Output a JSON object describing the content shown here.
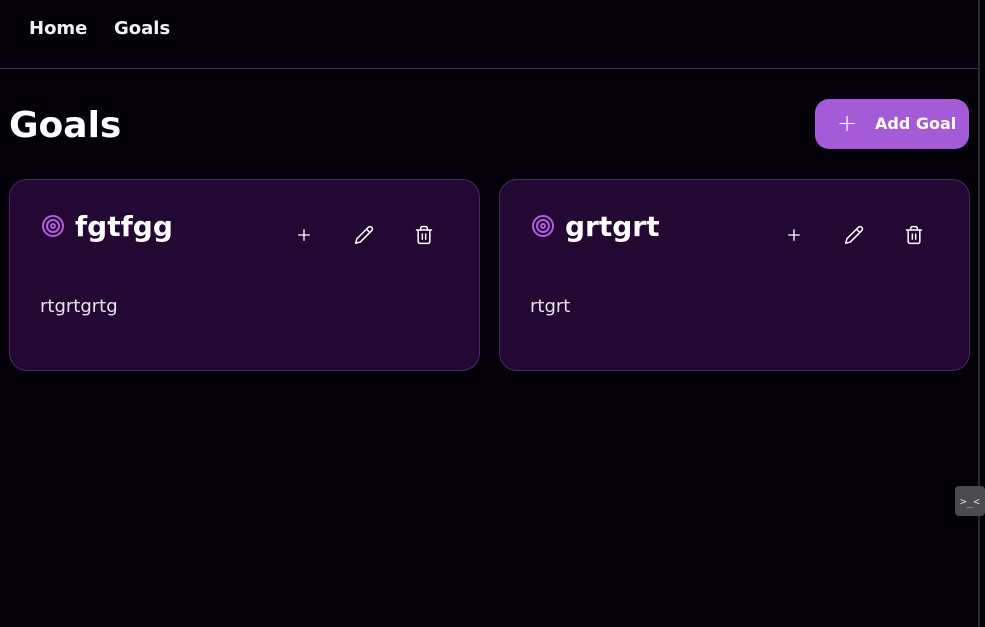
{
  "nav": {
    "home_label": "Home",
    "goals_label": "Goals"
  },
  "header": {
    "title": "Goals",
    "add_button_label": "Add Goal",
    "add_button_icon": "+"
  },
  "goals": [
    {
      "title": "fgtfgg",
      "description": "rtgrtgrtg",
      "icon": "target-icon"
    },
    {
      "title": "grtgrt",
      "description": "rtgrt",
      "icon": "target-icon"
    }
  ],
  "widget": {
    "text": ">_<"
  },
  "colors": {
    "background": "#040208",
    "card_background": "#220833",
    "card_border": "#4a2768",
    "accent": "#a55bd8",
    "icon_accent": "#b35ce0"
  }
}
